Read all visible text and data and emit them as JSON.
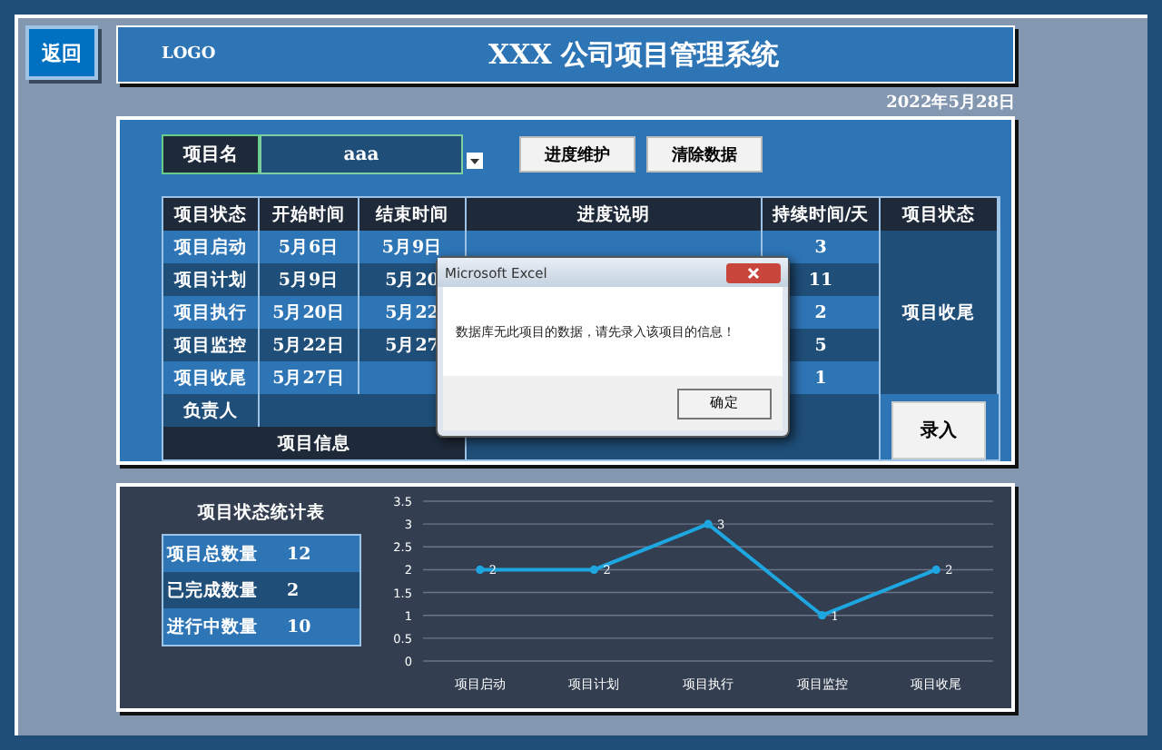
{
  "back_button": "返回",
  "header": {
    "logo": "LOGO",
    "title": "XXX 公司项目管理系统",
    "date": "2022年5月28日"
  },
  "project_form": {
    "label": "项目名",
    "value": "aaa",
    "buttons": [
      "进度维护",
      "清除数据"
    ]
  },
  "table": {
    "columns": [
      "项目状态",
      "开始时间",
      "结束时间",
      "进度说明",
      "持续时间/天",
      "项目状态"
    ],
    "rows": [
      {
        "stage": "项目启动",
        "start": "5月6日",
        "end": "5月9日",
        "duration": "3"
      },
      {
        "stage": "项目计划",
        "start": "5月9日",
        "end": "5月20",
        "duration": "11"
      },
      {
        "stage": "项目执行",
        "start": "5月20日",
        "end": "5月22",
        "duration": "2"
      },
      {
        "stage": "项目监控",
        "start": "5月22日",
        "end": "5月27",
        "duration": "5"
      },
      {
        "stage": "项目收尾",
        "start": "5月27日",
        "end": "",
        "duration": "1"
      }
    ],
    "status": "项目收尾",
    "owner_label": "负责人",
    "info_label": "项目信息"
  },
  "submit_button": "录入",
  "stats": {
    "title": "项目状态统计表",
    "rows": [
      {
        "label": "项目总数量",
        "value": "12"
      },
      {
        "label": "已完成数量",
        "value": "2"
      },
      {
        "label": "进行中数量",
        "value": "10"
      }
    ]
  },
  "chart_data": {
    "type": "line",
    "categories": [
      "项目启动",
      "项目计划",
      "项目执行",
      "项目监控",
      "项目收尾"
    ],
    "series": [
      {
        "color": "#1ea6e0",
        "marker": true,
        "values": [
          2,
          2,
          3,
          1,
          2
        ]
      }
    ],
    "grid": true,
    "ylim": [
      0,
      3.5
    ],
    "yticks": [
      0,
      0.5,
      1,
      1.5,
      2,
      2.5,
      3,
      3.5
    ],
    "data_labels": true
  },
  "dialog": {
    "title": "Microsoft Excel",
    "message": "数据库无此项目的数据，请先录入该项目的信息！",
    "ok_button": "确定"
  }
}
